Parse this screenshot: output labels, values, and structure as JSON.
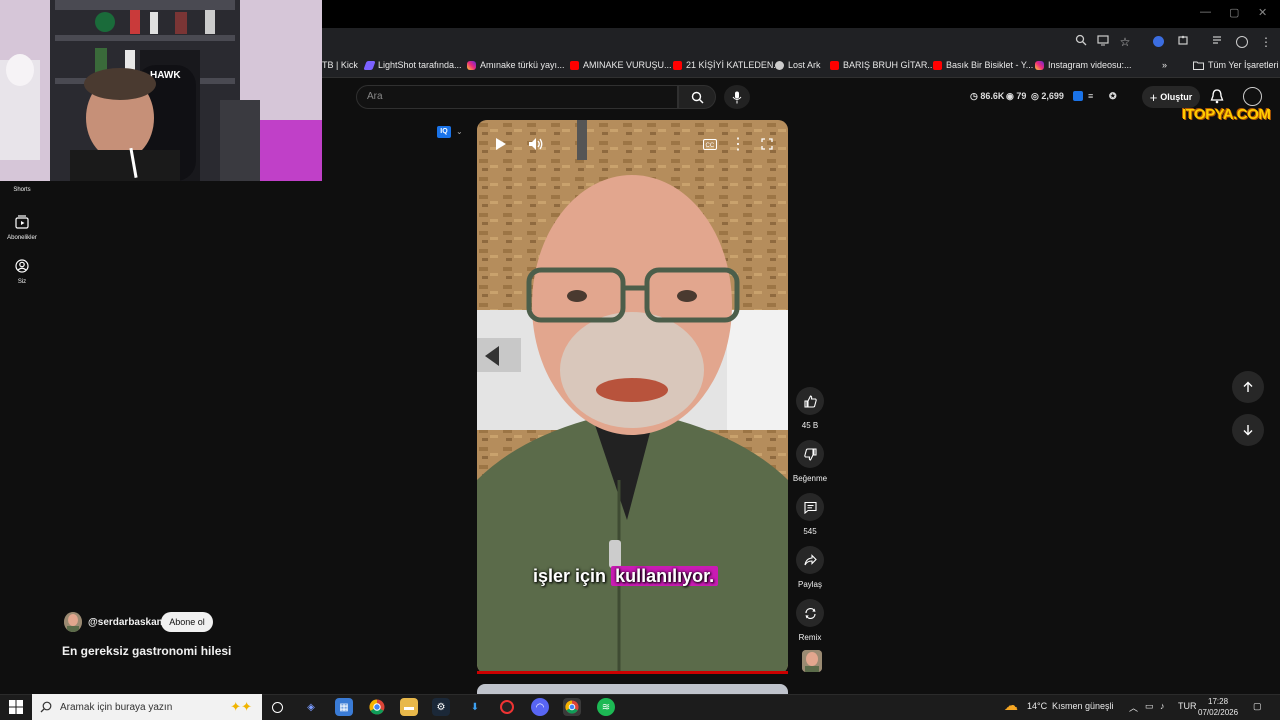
{
  "window": {
    "minimize": "—",
    "maximize": "▢",
    "close": "✕"
  },
  "bookmarks": [
    {
      "label": "TB | Kick",
      "icon": "kick-icon"
    },
    {
      "label": "LightShot tarafında...",
      "icon": "lightshot-icon"
    },
    {
      "label": "Amınake türkü yayı...",
      "icon": "instagram-icon"
    },
    {
      "label": "AMINAKE VURUŞU...",
      "icon": "youtube-icon"
    },
    {
      "label": "21 KİŞİYİ KATLEDEN...",
      "icon": "youtube-icon"
    },
    {
      "label": "Lost Ark",
      "icon": "globe-icon"
    },
    {
      "label": "BARIŞ BRUH GİTAR...",
      "icon": "youtube-icon"
    },
    {
      "label": "Basık Bir Bisiklet - Y...",
      "icon": "youtube-icon"
    },
    {
      "label": "Instagram videosu:...",
      "icon": "instagram-icon"
    }
  ],
  "bookmarks_overflow": "»",
  "all_bookmarks": "Tüm Yer İşaretleri",
  "header": {
    "search_placeholder": "Ara",
    "stat_views": "86.6K",
    "stat_comments": "79",
    "stat_other": "2,699",
    "create_label": "Oluştur"
  },
  "watermark": "ITOPYA.COM",
  "sidebar": [
    {
      "label": "Shorts",
      "icon": "shorts-icon"
    },
    {
      "label": "Abonelikler",
      "icon": "subscriptions-icon"
    },
    {
      "label": "Siz",
      "icon": "account-icon"
    }
  ],
  "player": {
    "caption_plain": "işler için",
    "caption_highlight": "kullanılıyor.",
    "progress": 1.0
  },
  "actions": {
    "like_count": "45 B",
    "dislike_label": "Beğenme",
    "comment_count": "545",
    "share_label": "Paylaş",
    "remix_label": "Remix"
  },
  "channel": {
    "handle": "@serdarbaskan",
    "subscribe_label": "Abone ol",
    "video_title": "En gereksiz gastronomi hilesi"
  },
  "taskbar": {
    "search_placeholder": "Aramak için buraya yazın",
    "weather": "14°C",
    "weather_desc": "Kısmen güneşli",
    "lang": "TUR",
    "time": "17:28",
    "date": "07/02/2026"
  }
}
